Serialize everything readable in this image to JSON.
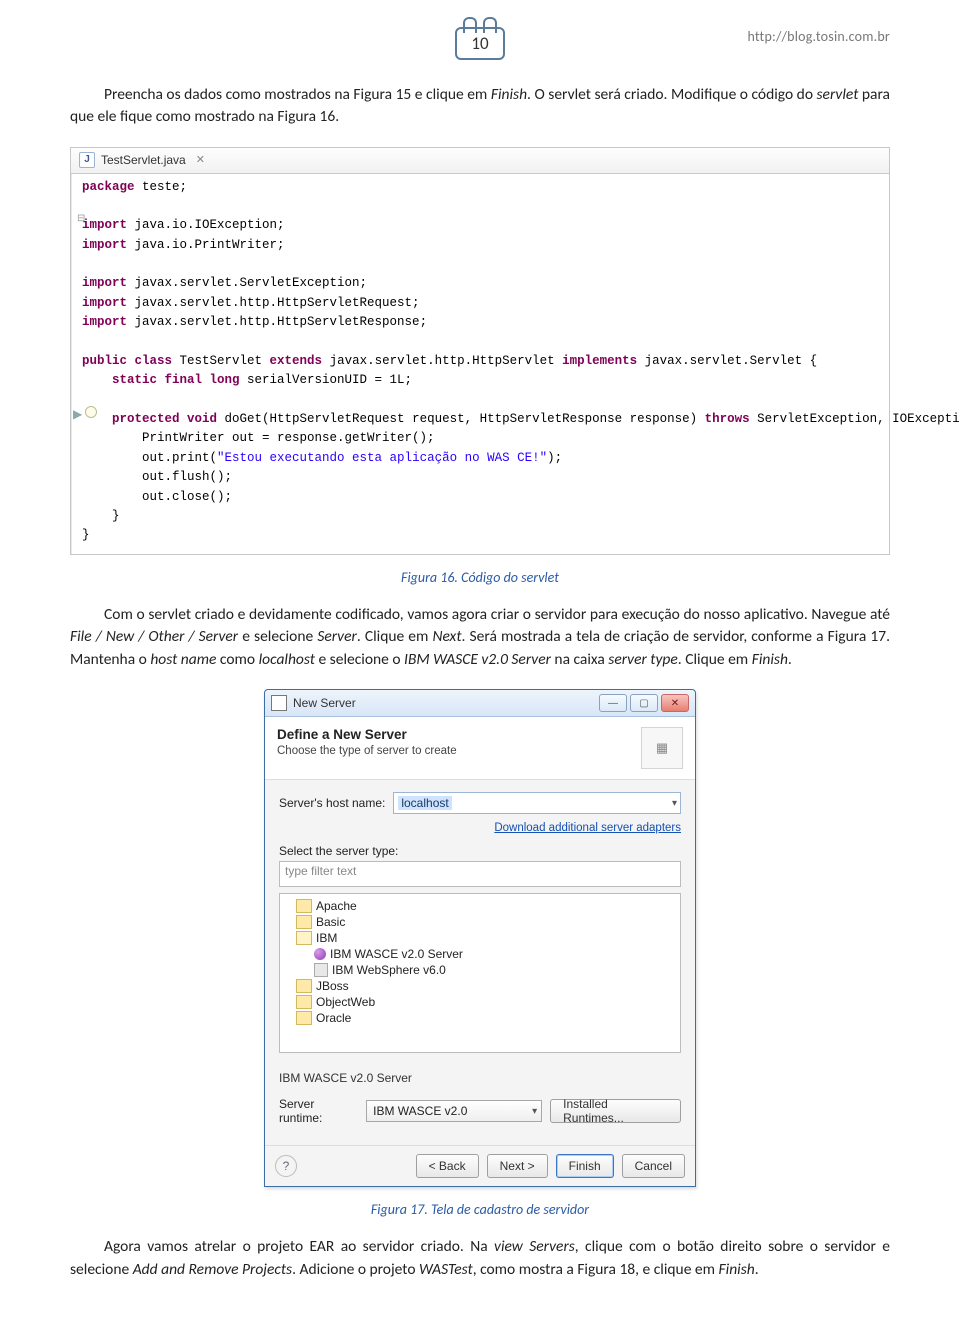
{
  "header": {
    "page_number": "10",
    "url": "http://blog.tosin.com.br"
  },
  "paragraph1_pre": "Preencha os dados como mostrados na Figura 15 e clique em ",
  "paragraph1_em1": "Finish",
  "paragraph1_mid": ". O servlet será criado. Modifique o código do ",
  "paragraph1_em2": "servlet",
  "paragraph1_post": " para que ele fique como mostrado na Figura 16.",
  "editor": {
    "tab_label": "TestServlet.java",
    "code_lines": {
      "l1_kw": "package",
      "l1_rest": " teste;",
      "l3_kw": "import",
      "l3_rest": " java.io.IOException;",
      "l4_kw": "import",
      "l4_rest": " java.io.PrintWriter;",
      "l6_kw": "import",
      "l6_rest": " javax.servlet.ServletException;",
      "l7_kw": "import",
      "l7_rest": " javax.servlet.http.HttpServletRequest;",
      "l8_kw": "import",
      "l8_rest": " javax.servlet.http.HttpServletResponse;",
      "l10a": "public class",
      "l10b": " TestServlet ",
      "l10c": "extends",
      "l10d": " javax.servlet.http.HttpServlet ",
      "l10e": "implements",
      "l10f": " javax.servlet.Servlet {",
      "l11a": "    static final long",
      "l11b": " serialVersionUID = 1L;",
      "l13a": "    protected void",
      "l13b": " doGet(HttpServletRequest request, HttpServletResponse response) ",
      "l13c": "throws",
      "l13d": " ServletException, IOException {",
      "l14": "        PrintWriter out = response.getWriter();",
      "l15a": "        out.print(",
      "l15b": "\"Estou executando esta aplicação no WAS CE!\"",
      "l15c": ");",
      "l16": "        out.flush();",
      "l17": "        out.close();",
      "l18": "    }",
      "l19": "}"
    }
  },
  "caption1": "Figura 16. Código do servlet",
  "p2_a": "Com o servlet criado e devidamente codificado, vamos agora criar o servidor para execução do nosso aplicativo. Navegue até ",
  "p2_b": "File / New / Other / Server",
  "p2_c": " e selecione ",
  "p2_d": "Server",
  "p2_e": ". Clique em ",
  "p2_f": "Next",
  "p2_g": ". Será mostrada a tela de criação de servidor, conforme a Figura 17. Mantenha o ",
  "p2_h": "host name",
  "p2_i": " como ",
  "p2_j": "localhost",
  "p2_k": " e selecione o ",
  "p2_l": "IBM WASCE v2.0 Server",
  "p2_m": " na  caixa ",
  "p2_n": "server type",
  "p2_o": ". Clique em ",
  "p2_p": "Finish",
  "p2_q": ".",
  "dialog": {
    "title": "New Server",
    "heading": "Define a New Server",
    "subheading": "Choose the type of server to create",
    "host_label": "Server's host name:",
    "host_value": "localhost",
    "download_link": "Download additional server adapters",
    "select_label": "Select the server type:",
    "filter_text": "type filter text",
    "tree": {
      "apache": "Apache",
      "basic": "Basic",
      "ibm": "IBM",
      "ibm_wasce": "IBM WASCE v2.0 Server",
      "ibm_ws": "IBM WebSphere v6.0",
      "jboss": "JBoss",
      "objectweb": "ObjectWeb",
      "oracle": "Oracle"
    },
    "status": "IBM WASCE v2.0 Server",
    "runtime_label": "Server runtime:",
    "runtime_value": "IBM WASCE v2.0",
    "installed_btn": "Installed Runtimes...",
    "back": "< Back",
    "next": "Next >",
    "finish": "Finish",
    "cancel": "Cancel"
  },
  "caption2": "Figura 17. Tela de cadastro de servidor",
  "p3_a": "Agora vamos atrelar o projeto EAR ao servidor criado. Na ",
  "p3_b": "view Servers",
  "p3_c": ", clique com o botão direito sobre o servidor e selecione ",
  "p3_d": "Add and Remove Projects",
  "p3_e": ". Adicione o projeto ",
  "p3_f": "WASTest",
  "p3_g": ", como mostra a Figura 18, e clique em ",
  "p3_h": "Finish",
  "p3_i": "."
}
